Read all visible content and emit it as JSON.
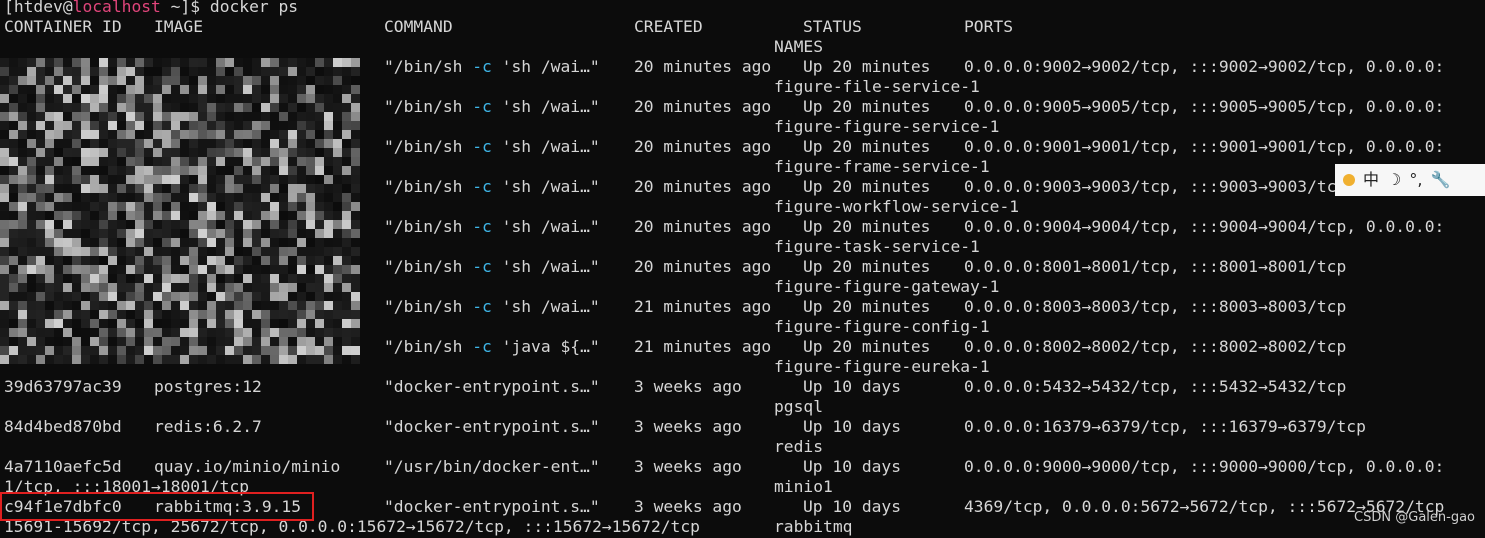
{
  "prompt": {
    "open": "[",
    "user": "htdev@",
    "host": "localhost",
    "path_close": " ~]$ ",
    "command": "docker ps"
  },
  "headers": {
    "container_id": "CONTAINER ID",
    "image": "IMAGE",
    "command": "COMMAND",
    "created": "CREATED",
    "status": "STATUS",
    "ports": "PORTS",
    "names": "NAMES"
  },
  "rows": [
    {
      "cmd_a": "\"/bin/sh ",
      "cmd_flag": "-c",
      "cmd_b": " 'sh /wai…\"",
      "created": "20 minutes ago",
      "status": "Up 20 minutes",
      "ports": "0.0.0.0:9002→9002/tcp, :::9002→9002/tcp, 0.0.0.0:",
      "name": "figure-file-service-1"
    },
    {
      "cmd_a": "\"/bin/sh ",
      "cmd_flag": "-c",
      "cmd_b": " 'sh /wai…\"",
      "created": "20 minutes ago",
      "status": "Up 20 minutes",
      "ports": "0.0.0.0:9005→9005/tcp, :::9005→9005/tcp, 0.0.0.0:",
      "name": "figure-figure-service-1"
    },
    {
      "cmd_a": "\"/bin/sh ",
      "cmd_flag": "-c",
      "cmd_b": " 'sh /wai…\"",
      "created": "20 minutes ago",
      "status": "Up 20 minutes",
      "ports": "0.0.0.0:9001→9001/tcp, :::9001→9001/tcp, 0.0.0.0:",
      "name": "figure-frame-service-1"
    },
    {
      "cmd_a": "\"/bin/sh ",
      "cmd_flag": "-c",
      "cmd_b": " 'sh /wai…\"",
      "created": "20 minutes ago",
      "status": "Up 20 minutes",
      "ports": "0.0.0.0:9003→9003/tcp, :::9003→9003/tcp, 0.0.0.0:",
      "name": "figure-workflow-service-1"
    },
    {
      "cmd_a": "\"/bin/sh ",
      "cmd_flag": "-c",
      "cmd_b": " 'sh /wai…\"",
      "created": "20 minutes ago",
      "status": "Up 20 minutes",
      "ports": "0.0.0.0:9004→9004/tcp, :::9004→9004/tcp, 0.0.0.0:",
      "name": "figure-task-service-1"
    },
    {
      "cmd_a": "\"/bin/sh ",
      "cmd_flag": "-c",
      "cmd_b": " 'sh /wai…\"",
      "created": "20 minutes ago",
      "status": "Up 20 minutes",
      "ports": "0.0.0.0:8001→8001/tcp, :::8001→8001/tcp",
      "name": "figure-figure-gateway-1"
    },
    {
      "cmd_a": "\"/bin/sh ",
      "cmd_flag": "-c",
      "cmd_b": " 'sh /wai…\"",
      "created": "21 minutes ago",
      "status": "Up 20 minutes",
      "ports": "0.0.0.0:8003→8003/tcp, :::8003→8003/tcp",
      "name": "figure-figure-config-1"
    },
    {
      "cmd_a": "\"/bin/sh ",
      "cmd_flag": "-c",
      "cmd_b": " 'java ${…\"",
      "created": "21 minutes ago",
      "status": "Up 20 minutes",
      "ports": "0.0.0.0:8002→8002/tcp, :::8002→8002/tcp",
      "name": "figure-figure-eureka-1"
    }
  ],
  "rows_plain": [
    {
      "id": "39d63797ac39",
      "image": "postgres:12",
      "command": "\"docker-entrypoint.s…\"",
      "created": "3 weeks ago",
      "status": "Up 10 days",
      "ports": "0.0.0.0:5432→5432/tcp, :::5432→5432/tcp",
      "name": "pgsql"
    },
    {
      "id": "84d4bed870bd",
      "image": "redis:6.2.7",
      "command": "\"docker-entrypoint.s…\"",
      "created": "3 weeks ago",
      "status": "Up 10 days",
      "ports": "0.0.0.0:16379→6379/tcp, :::16379→6379/tcp",
      "name": "redis"
    },
    {
      "id": "4a7110aefc5d",
      "image": "quay.io/minio/minio",
      "command": "\"/usr/bin/docker-ent…\"",
      "created": "3 weeks ago",
      "status": "Up 10 days",
      "ports": "0.0.0.0:9000→9000/tcp, :::9000→9000/tcp, 0.0.0.0:",
      "wrap": "1/tcp, :::18001→18001/tcp",
      "name": "minio1"
    },
    {
      "id": "c94f1e7dbfc0",
      "image": "rabbitmq:3.9.15",
      "command": "\"docker-entrypoint.s…\"",
      "created": "3 weeks ago",
      "status": "Up 10 days",
      "ports": "4369/tcp, 0.0.0.0:5672→5672/tcp, :::5672→5672/tcp",
      "wrap": "15691-15692/tcp, 25672/tcp, 0.0.0.0:15672→15672/tcp, :::15672→15672/tcp",
      "name": "rabbitmq"
    }
  ],
  "overlay_toolbar": {
    "zh": "中",
    "moon": "☽",
    "dot": "°,",
    "wrench": "🔧"
  },
  "watermark": "CSDN @Galen-gao",
  "colors": {
    "background": "#0c0c0c",
    "text": "#d6d6d6",
    "host": "#e0457b",
    "flag": "#3fb6e8",
    "highlight": "#e02020"
  }
}
